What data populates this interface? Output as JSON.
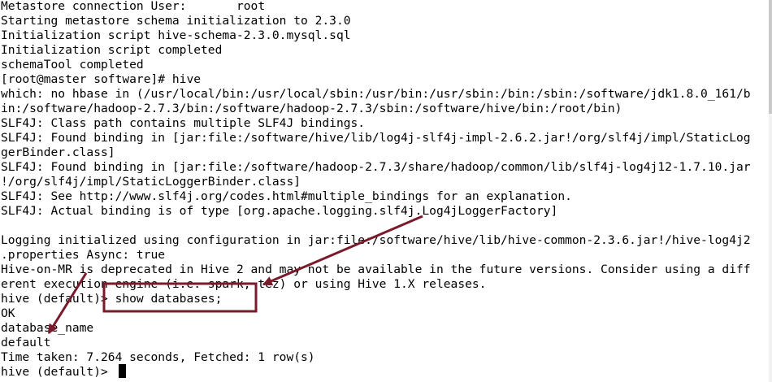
{
  "terminal": {
    "lines": [
      "Metastore connection User:\t root",
      "Starting metastore schema initialization to 2.3.0",
      "Initialization script hive-schema-2.3.0.mysql.sql",
      "Initialization script completed",
      "schemaTool completed",
      "[root@master software]# hive",
      "which: no hbase in (/usr/local/bin:/usr/local/sbin:/usr/bin:/usr/sbin:/bin:/sbin:/software/jdk1.8.0_161/b",
      "in:/software/hadoop-2.7.3/bin:/software/hadoop-2.7.3/sbin:/software/hive/bin:/root/bin)",
      "SLF4J: Class path contains multiple SLF4J bindings.",
      "SLF4J: Found binding in [jar:file:/software/hive/lib/log4j-slf4j-impl-2.6.2.jar!/org/slf4j/impl/StaticLog",
      "gerBinder.class]",
      "SLF4J: Found binding in [jar:file:/software/hadoop-2.7.3/share/hadoop/common/lib/slf4j-log4j12-1.7.10.jar",
      "!/org/slf4j/impl/StaticLoggerBinder.class]",
      "SLF4J: See http://www.slf4j.org/codes.html#multiple_bindings for an explanation.",
      "SLF4J: Actual binding is of type [org.apache.logging.slf4j.Log4jLoggerFactory]",
      "",
      "Logging initialized using configuration in jar:file:/software/hive/lib/hive-common-2.3.6.jar!/hive-log4j2",
      ".properties Async: true",
      "Hive-on-MR is deprecated in Hive 2 and may not be available in the future versions. Consider using a diff",
      "erent execution engine (i.e. spark, tez) or using Hive 1.X releases.",
      "hive (default)> show databases;",
      "OK",
      "database_name",
      "default",
      "Time taken: 7.264 seconds, Fetched: 1 row(s)",
      "hive (default)> "
    ]
  },
  "annotations": {
    "color": "#7b1a2a"
  }
}
